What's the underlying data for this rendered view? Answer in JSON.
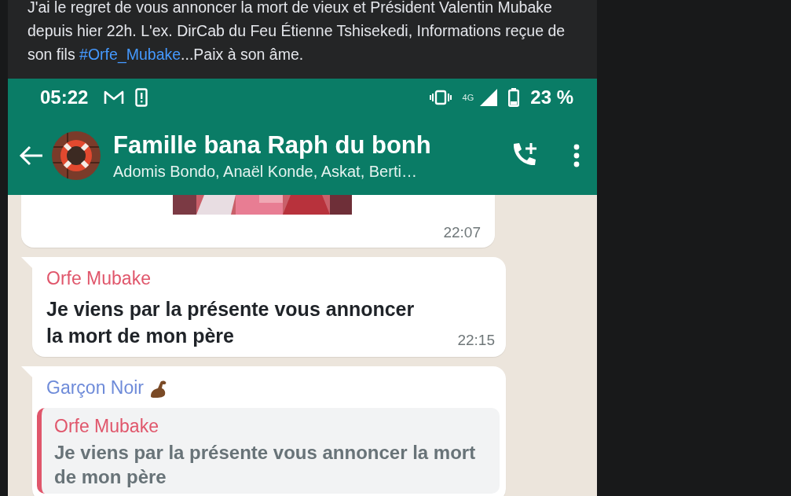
{
  "post": {
    "text": "J'ai le regret de vous annoncer la mort de vieux et Président Valentin Mubake depuis hier 22h. L'ex. DirCab du Feu Étienne Tshisekedi, Informations reçue de son fils ",
    "hashtag": "#Orfe_Mubake",
    "text_end": "...Paix à son âme."
  },
  "phone": {
    "status_bar": {
      "time": "05:22",
      "network": "4G",
      "battery": "23 %"
    },
    "chat": {
      "title": "Famille bana Raph du bonh",
      "members": "Adomis Bondo, Anaël Konde, Askat, Berti…"
    },
    "messages": [
      {
        "kind": "media",
        "tail": false,
        "time": "22:07"
      },
      {
        "kind": "text",
        "tail": true,
        "sender": "Orfe Mubake",
        "color": "#e0566b",
        "text": "Je viens par la présente vous annoncer la mort de mon père",
        "time": "22:15"
      },
      {
        "kind": "reply",
        "tail": true,
        "sender": "Garçon Noir",
        "color": "#6e8bd9",
        "quote": {
          "sender": "Orfe Mubake",
          "color": "#e0566b",
          "text": "Je viens par la présente vous annoncer la mort de mon père"
        }
      }
    ]
  }
}
